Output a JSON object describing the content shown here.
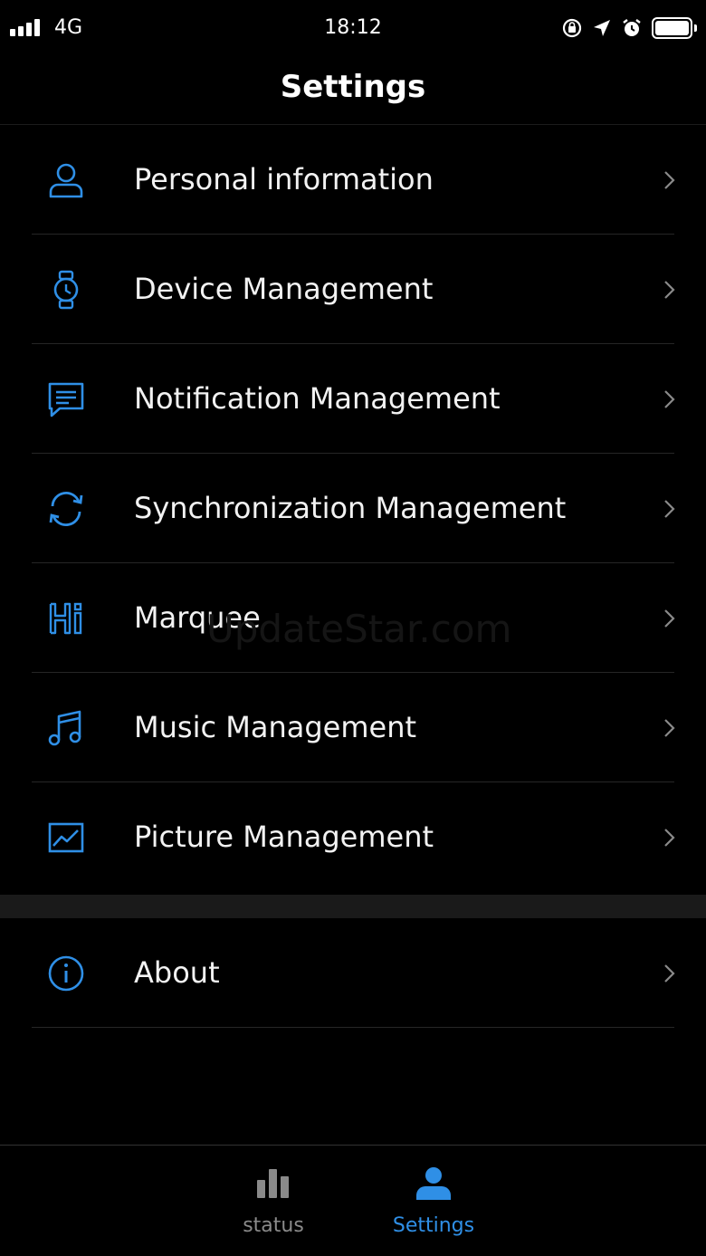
{
  "status_bar": {
    "network": "4G",
    "time": "18:12"
  },
  "nav": {
    "title": "Settings"
  },
  "menu": [
    {
      "label": "Personal information",
      "icon": "person-icon"
    },
    {
      "label": "Device Management",
      "icon": "watch-icon"
    },
    {
      "label": "Notification Management",
      "icon": "message-icon"
    },
    {
      "label": "Synchronization Management",
      "icon": "sync-icon"
    },
    {
      "label": "Marquee",
      "icon": "hi-icon"
    },
    {
      "label": "Music Management",
      "icon": "music-icon"
    },
    {
      "label": "Picture Management",
      "icon": "picture-icon"
    }
  ],
  "about": {
    "label": "About",
    "icon": "info-icon"
  },
  "watermark": "UpdateStar.com",
  "tab_bar": {
    "tabs": [
      {
        "label": "status",
        "icon": "bar-chart-icon",
        "active": false
      },
      {
        "label": "Settings",
        "icon": "person-icon",
        "active": true
      }
    ]
  },
  "colors": {
    "accent": "#2f8fe6",
    "inactive": "#8a8a8a",
    "background": "#000000"
  }
}
